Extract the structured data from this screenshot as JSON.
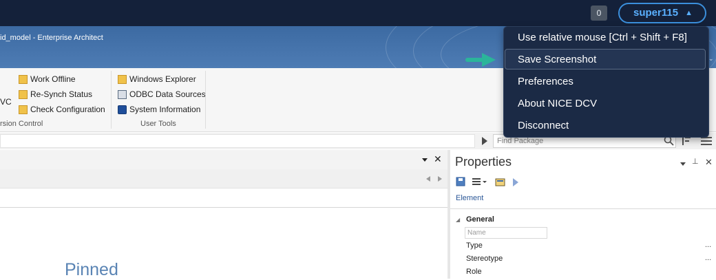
{
  "dcv": {
    "notification_count": "0",
    "user": "super115",
    "menu": [
      "Use relative mouse [Ctrl + Shift + F8]",
      "Save Screenshot",
      "Preferences",
      "About NICE DCV",
      "Disconnect"
    ],
    "highlighted_index": 1
  },
  "window": {
    "title": "id_model - Enterprise Architect"
  },
  "ribbon": {
    "version_control": {
      "label": "rsion Control",
      "partial": "VC",
      "items": [
        "Work Offline",
        "Re-Synch Status",
        "Check Configuration"
      ]
    },
    "user_tools": {
      "label": "User Tools",
      "items": [
        "Windows Explorer",
        "ODBC Data Sources",
        "System Information"
      ]
    }
  },
  "find": {
    "placeholder": "Find Package"
  },
  "left_panel": {
    "pinned_label": "Pinned"
  },
  "properties": {
    "title": "Properties",
    "tab": "Element",
    "section": "General",
    "name_placeholder": "Name",
    "rows": [
      "Type",
      "Stereotype",
      "Role"
    ],
    "ellipsis": "..."
  },
  "colors": {
    "dcv_bar": "#14213a",
    "dcv_accent": "#3b8fdc",
    "menu_bg": "#1b2a45",
    "ea_title": "#4574ad",
    "arrow": "#2bb59a"
  }
}
